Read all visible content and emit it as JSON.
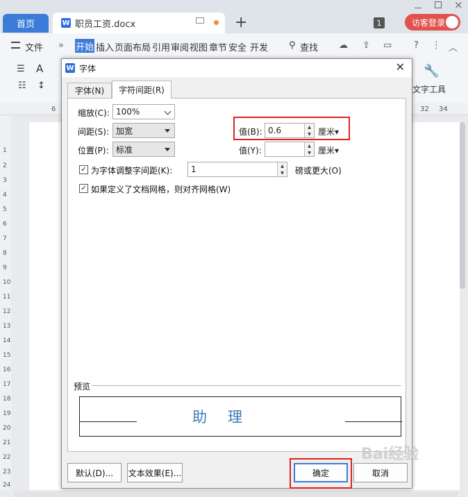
{
  "titlebar": {
    "home_tab": "首页",
    "doc_tab": "职员工资.docx",
    "badge": "1",
    "visitor": "访客登录"
  },
  "menubar": {
    "file": "文件",
    "items": [
      "开始",
      "插入",
      "页面布局",
      "引用",
      "审阅",
      "视图",
      "章节",
      "安全",
      "开发"
    ],
    "search": "查找"
  },
  "toolbar": {
    "text_tools": "文字工具"
  },
  "ruler": {
    "left_number": "6",
    "right_numbers": [
      "32",
      "34"
    ],
    "vertical_numbers": [
      "1",
      "2",
      "3",
      "4",
      "5",
      "6",
      "7",
      "8",
      "9",
      "10",
      "11",
      "12",
      "13",
      "14",
      "15",
      "16",
      "17",
      "18",
      "19",
      "20",
      "21",
      "22",
      "23",
      "24"
    ]
  },
  "dialog": {
    "title": "字体",
    "tabs": [
      "字体(N)",
      "字符间距(R)"
    ],
    "scale_label": "缩放(C):",
    "scale_value": "100%",
    "spacing_label": "间距(S):",
    "spacing_value": "加宽",
    "spacing_amount_label": "值(B):",
    "spacing_amount_value": "0.6",
    "spacing_unit": "厘米",
    "position_label": "位置(P):",
    "position_value": "标准",
    "position_amount_label": "值(Y):",
    "position_amount_value": "",
    "position_unit": "厘米",
    "kerning_label": "为字体调整字间距(K):",
    "kerning_value": "1",
    "kerning_suffix": "磅或更大(O)",
    "grid_label": "如果定义了文档网格，则对齐网格(W)",
    "preview_label": "预览",
    "preview_text": "助理",
    "default_button": "默认(D)...",
    "text_effect_button": "文本效果(E)...",
    "ok_button": "确定",
    "cancel_button": "取消"
  },
  "watermark": "Bai经验"
}
